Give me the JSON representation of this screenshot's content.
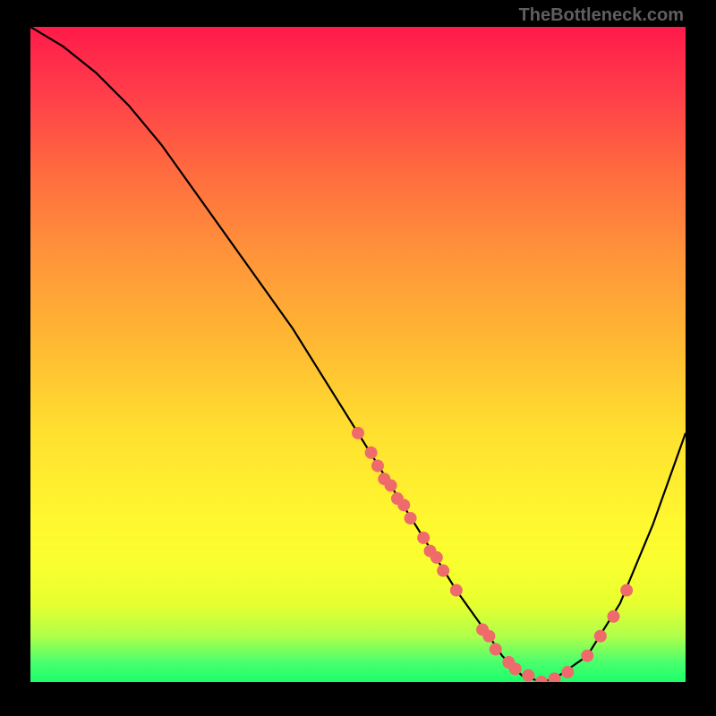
{
  "watermark": "TheBottleneck.com",
  "chart_data": {
    "type": "line",
    "title": "",
    "xlabel": "",
    "ylabel": "",
    "xlim": [
      0,
      100
    ],
    "ylim": [
      0,
      100
    ],
    "curve": {
      "x": [
        0,
        5,
        10,
        15,
        20,
        25,
        30,
        35,
        40,
        45,
        50,
        55,
        60,
        65,
        70,
        72,
        75,
        78,
        80,
        85,
        90,
        95,
        100
      ],
      "y": [
        100,
        97,
        93,
        88,
        82,
        75,
        68,
        61,
        54,
        46,
        38,
        30,
        22,
        14,
        7,
        4,
        1,
        0,
        0.5,
        4,
        12,
        24,
        38
      ]
    },
    "scatter": [
      {
        "x": 50,
        "y": 38
      },
      {
        "x": 52,
        "y": 35
      },
      {
        "x": 53,
        "y": 33
      },
      {
        "x": 54,
        "y": 31
      },
      {
        "x": 55,
        "y": 30
      },
      {
        "x": 56,
        "y": 28
      },
      {
        "x": 57,
        "y": 27
      },
      {
        "x": 58,
        "y": 25
      },
      {
        "x": 60,
        "y": 22
      },
      {
        "x": 61,
        "y": 20
      },
      {
        "x": 62,
        "y": 19
      },
      {
        "x": 63,
        "y": 17
      },
      {
        "x": 65,
        "y": 14
      },
      {
        "x": 69,
        "y": 8
      },
      {
        "x": 70,
        "y": 7
      },
      {
        "x": 71,
        "y": 5
      },
      {
        "x": 73,
        "y": 3
      },
      {
        "x": 74,
        "y": 2
      },
      {
        "x": 76,
        "y": 1
      },
      {
        "x": 78,
        "y": 0
      },
      {
        "x": 80,
        "y": 0.5
      },
      {
        "x": 82,
        "y": 1.5
      },
      {
        "x": 85,
        "y": 4
      },
      {
        "x": 87,
        "y": 7
      },
      {
        "x": 89,
        "y": 10
      },
      {
        "x": 91,
        "y": 14
      }
    ],
    "scatter_color": "#ef6a6a",
    "curve_color": "#000000"
  }
}
